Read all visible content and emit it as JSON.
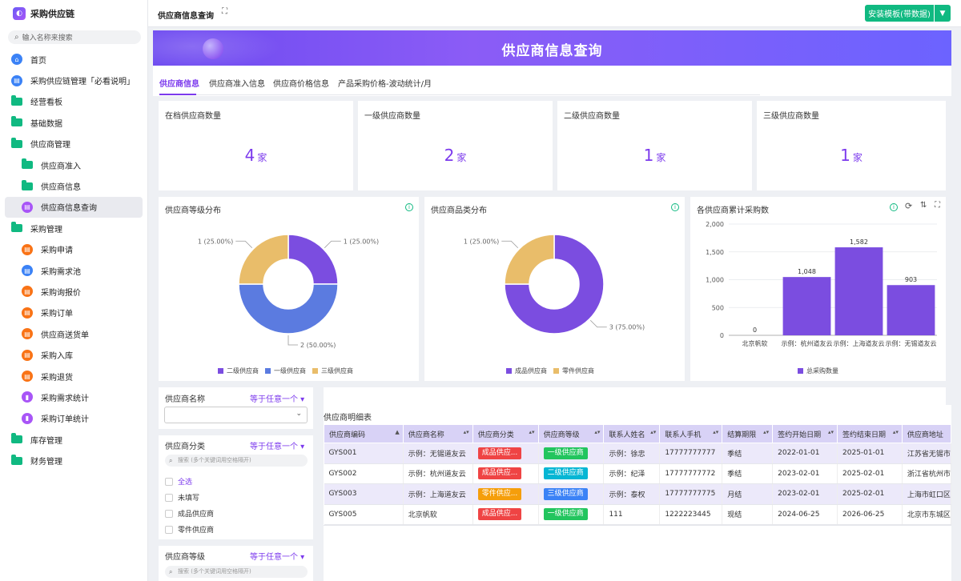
{
  "app": {
    "name": "采购供应链",
    "logo_glyph": "◐"
  },
  "search": {
    "placeholder": "输入名称来搜索"
  },
  "nav": [
    {
      "label": "首页",
      "icon": "home-icon",
      "color": "#3b82f6"
    },
    {
      "label": "采购供应链管理「必看说明」",
      "icon": "doc-icon",
      "color": "#3b82f6"
    },
    {
      "label": "经营看板",
      "icon": "folder-icon"
    },
    {
      "label": "基础数据",
      "icon": "folder-icon"
    },
    {
      "label": "供应商管理",
      "icon": "folder-open-icon"
    },
    {
      "label": "供应商准入",
      "icon": "folder-icon",
      "sub": true
    },
    {
      "label": "供应商信息",
      "icon": "folder-icon",
      "sub": true
    },
    {
      "label": "供应商信息查询",
      "icon": "report-icon",
      "sub": true,
      "active": true,
      "color": "#a855f7"
    },
    {
      "label": "采购管理",
      "icon": "folder-open-icon"
    },
    {
      "label": "采购申请",
      "icon": "form-icon",
      "sub": true,
      "color": "#f97316"
    },
    {
      "label": "采购需求池",
      "icon": "form-icon",
      "sub": true,
      "color": "#3b82f6"
    },
    {
      "label": "采购询报价",
      "icon": "form-icon",
      "sub": true,
      "color": "#f97316"
    },
    {
      "label": "采购订单",
      "icon": "form-icon",
      "sub": true,
      "color": "#f97316"
    },
    {
      "label": "供应商送货单",
      "icon": "form-icon",
      "sub": true,
      "color": "#f97316"
    },
    {
      "label": "采购入库",
      "icon": "form-icon",
      "sub": true,
      "color": "#f97316"
    },
    {
      "label": "采购退货",
      "icon": "form-icon",
      "sub": true,
      "color": "#f97316"
    },
    {
      "label": "采购需求统计",
      "icon": "chart-icon",
      "sub": true,
      "color": "#a855f7"
    },
    {
      "label": "采购订单统计",
      "icon": "chart-icon",
      "sub": true,
      "color": "#a855f7"
    },
    {
      "label": "库存管理",
      "icon": "folder-icon"
    },
    {
      "label": "财务管理",
      "icon": "folder-icon"
    }
  ],
  "topbar": {
    "title": "供应商信息查询",
    "install_label": "安装模板(带数据)"
  },
  "banner": {
    "title": "供应商信息查询"
  },
  "tabs": [
    "供应商信息",
    "供应商准入信息",
    "供应商价格信息",
    "产品采购价格-波动统计/月"
  ],
  "kpis": [
    {
      "label": "在档供应商数量",
      "value": "4",
      "unit": "家"
    },
    {
      "label": "一级供应商数量",
      "value": "2",
      "unit": "家"
    },
    {
      "label": "二级供应商数量",
      "value": "1",
      "unit": "家"
    },
    {
      "label": "三级供应商数量",
      "value": "1",
      "unit": "家"
    }
  ],
  "chart_data": [
    {
      "type": "pie",
      "title": "供应商等级分布",
      "slices": [
        {
          "name": "二级供应商",
          "value": 1,
          "label": "1 (25.00%)",
          "color": "#7b4de0"
        },
        {
          "name": "一级供应商",
          "value": 2,
          "label": "2 (50.00%)",
          "color": "#5b7be0"
        },
        {
          "name": "三级供应商",
          "value": 1,
          "label": "1 (25.00%)",
          "color": "#e9bd6a"
        }
      ]
    },
    {
      "type": "pie",
      "title": "供应商品类分布",
      "slices": [
        {
          "name": "成品供应商",
          "value": 3,
          "label": "3 (75.00%)",
          "color": "#7b4de0"
        },
        {
          "name": "零件供应商",
          "value": 1,
          "label": "1 (25.00%)",
          "color": "#e9bd6a"
        }
      ]
    },
    {
      "type": "bar",
      "title": "各供应商累计采购数",
      "categories": [
        "北京帆软",
        "示例：杭州道友云",
        "示例：上海道友云",
        "示例：无锡道友云"
      ],
      "series": [
        {
          "name": "总采购数量",
          "values": [
            0,
            1048,
            1582,
            903
          ]
        }
      ],
      "value_labels": [
        "0",
        "1,048",
        "1,582",
        "903"
      ],
      "yticks": [
        "0",
        "500",
        "1,000",
        "1,500",
        "2,000"
      ],
      "ylim": [
        0,
        2000
      ],
      "color": "#7b4de0",
      "legend": "bottom"
    }
  ],
  "filters": [
    {
      "title": "供应商名称",
      "op": "等于任意一个"
    },
    {
      "title": "供应商分类",
      "op": "等于任意一个",
      "search_placeholder": "搜索 (多个关键词用空格隔开)",
      "options": [
        "全选",
        "未填写",
        "成品供应商",
        "零件供应商"
      ]
    },
    {
      "title": "供应商等级",
      "op": "等于任意一个",
      "search_placeholder": "搜索 (多个关键词用空格隔开)"
    }
  ],
  "table": {
    "title": "供应商明细表",
    "columns": [
      "供应商编码",
      "供应商名称",
      "供应商分类",
      "供应商等级",
      "联系人姓名",
      "联系人手机",
      "结算期限",
      "签约开始日期",
      "签约结束日期",
      "供应商地址"
    ],
    "rows": [
      [
        "GYS001",
        "示例：无锡道友云",
        "成品供应...",
        "一级供应商",
        "示例：徐忠",
        "17777777777",
        "季结",
        "2022-01-01",
        "2025-01-01",
        "江苏省无锡市"
      ],
      [
        "GYS002",
        "示例：杭州道友云",
        "成品供应...",
        "二级供应商",
        "示例：纪泽",
        "17777777772",
        "季结",
        "2023-02-01",
        "2025-02-01",
        "浙江省杭州市"
      ],
      [
        "GYS003",
        "示例：上海道友云",
        "零件供应...",
        "三级供应商",
        "示例：泰权",
        "17777777775",
        "月结",
        "2023-02-01",
        "2025-02-01",
        "上海市虹口区"
      ],
      [
        "GYS005",
        "北京帆软",
        "成品供应...",
        "一级供应商",
        "111",
        "1222223445",
        "现结",
        "2024-06-25",
        "2026-06-25",
        "北京市东城区"
      ]
    ],
    "category_colors": {
      "成品供应...": "#ef4444",
      "零件供应...": "#f59e0b"
    },
    "level_colors": {
      "一级供应商": "#22c55e",
      "二级供应商": "#06b6d4",
      "三级供应商": "#3b82f6"
    }
  }
}
